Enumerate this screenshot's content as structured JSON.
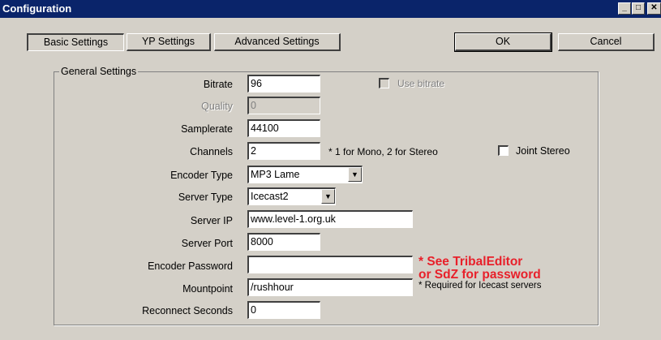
{
  "window": {
    "title": "Configuration",
    "controls": {
      "minimize": "_",
      "maximize": "□",
      "close": "✕"
    }
  },
  "tabs": [
    {
      "label": "Basic Settings",
      "active": true
    },
    {
      "label": "YP Settings",
      "active": false
    },
    {
      "label": "Advanced Settings",
      "active": false
    }
  ],
  "buttons": {
    "ok": "OK",
    "cancel": "Cancel"
  },
  "group": {
    "title": "General Settings"
  },
  "fields": {
    "bitrate": {
      "label": "Bitrate",
      "value": "96"
    },
    "use_bitrate": {
      "label": "Use bitrate",
      "checked": false,
      "enabled": false
    },
    "quality": {
      "label": "Quality",
      "value": "0",
      "enabled": false
    },
    "samplerate": {
      "label": "Samplerate",
      "value": "44100"
    },
    "channels": {
      "label": "Channels",
      "value": "2",
      "hint": "* 1 for Mono, 2 for Stereo"
    },
    "joint_stereo": {
      "label": "Joint Stereo",
      "checked": false
    },
    "encoder_type": {
      "label": "Encoder Type",
      "value": "MP3 Lame"
    },
    "server_type": {
      "label": "Server Type",
      "value": "Icecast2"
    },
    "server_ip": {
      "label": "Server IP",
      "value": "www.level-1.org.uk"
    },
    "server_port": {
      "label": "Server Port",
      "value": "8000"
    },
    "encoder_password": {
      "label": "Encoder Password",
      "value": ""
    },
    "mountpoint": {
      "label": "Mountpoint",
      "value": "/rushhour",
      "hint": "* Required for Icecast servers"
    },
    "reconnect_seconds": {
      "label": "Reconnect Seconds",
      "value": "0"
    }
  },
  "password_note": {
    "line1": "* See TribalEditor",
    "line2": "or SdZ for password",
    "color": "#e8202a"
  },
  "colors": {
    "titlebar": "#0a246a",
    "face": "#d4d0c8"
  }
}
